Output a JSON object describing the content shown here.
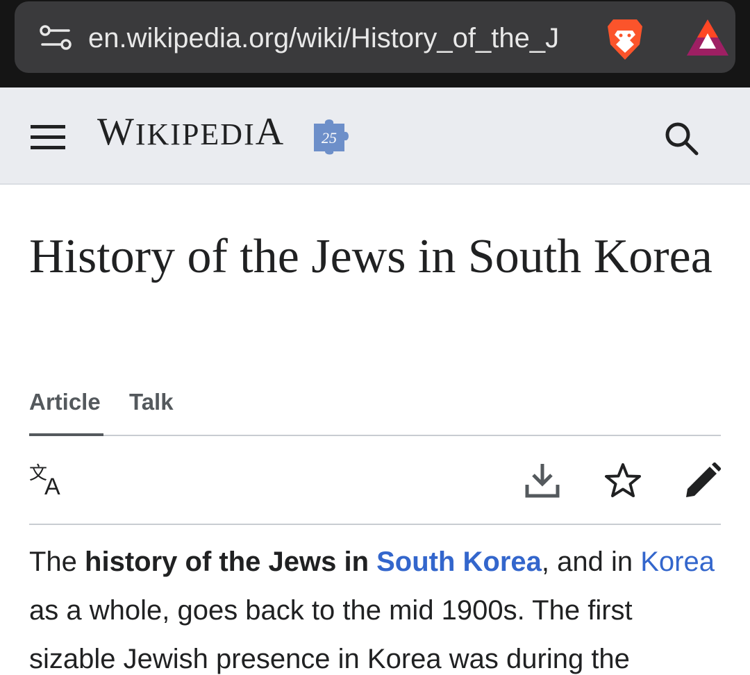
{
  "browser": {
    "url": "en.wikipedia.org/wiki/History_of_the_J"
  },
  "header": {
    "wordmark_first": "W",
    "wordmark_rest": "IKIPEDI",
    "wordmark_last": "A",
    "anniversary_badge": "25"
  },
  "article": {
    "title": "History of the Jews in South Korea",
    "tabs": [
      {
        "label": "Article",
        "selected": true
      },
      {
        "label": "Talk",
        "selected": false
      }
    ],
    "intro": {
      "t1": "The ",
      "bold1": "history of the Jews in ",
      "link_bold": "South Korea",
      "t2": ", and in ",
      "link": "Korea",
      "t3": " as a whole, goes back to the mid 1900s. The first sizable Jewish presence in Korea was during the"
    }
  },
  "colors": {
    "link": "#3366cc",
    "header_bg": "#eaecf0",
    "chrome_bg": "#151515",
    "url_pill": "#3a3a3c"
  },
  "icons": [
    "site-settings-icon",
    "brave-lion-icon",
    "bat-rewards-icon",
    "menu-icon",
    "wikipedia-25-puzzle-icon",
    "search-icon",
    "translate-icon",
    "download-icon",
    "star-icon",
    "edit-pencil-icon"
  ]
}
